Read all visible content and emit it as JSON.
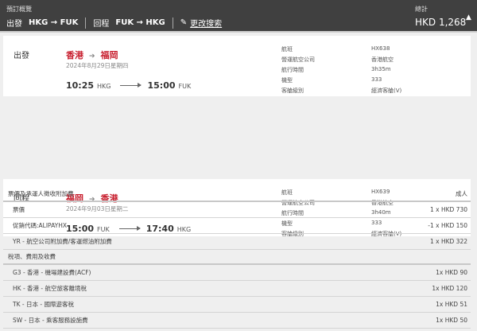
{
  "header": {
    "title": "預訂概覽",
    "outbound_label": "出發",
    "outbound_route": "HKG → FUK",
    "return_label": "回程",
    "return_route": "FUK → HKG",
    "edit_label": "更改搜索",
    "total_label": "總計",
    "total_amount": "HKD 1,268"
  },
  "flights": [
    {
      "label": "出發",
      "from": "香港",
      "to": "福岡",
      "date": "2024年8月29日星期四",
      "dep_time": "10:25",
      "dep_code": "HKG",
      "arr_time": "15:00",
      "arr_code": "FUK",
      "details": [
        {
          "k": "航班",
          "v": "HX638"
        },
        {
          "k": "營運航空公司",
          "v": "香港航空"
        },
        {
          "k": "航行時間",
          "v": "3h35m"
        },
        {
          "k": "機型",
          "v": "333"
        },
        {
          "k": "客艙級別",
          "v": "經濟客艙(V)"
        }
      ]
    },
    {
      "label": "回程",
      "from": "福岡",
      "to": "香港",
      "date": "2024年9月03日星期二",
      "dep_time": "15:00",
      "dep_code": "FUK",
      "arr_time": "17:40",
      "arr_code": "HKG",
      "details": [
        {
          "k": "航班",
          "v": "HX639"
        },
        {
          "k": "營運航空公司",
          "v": "香港航空"
        },
        {
          "k": "航行時間",
          "v": "3h40m"
        },
        {
          "k": "機型",
          "v": "333"
        },
        {
          "k": "客艙級別",
          "v": "經濟客艙(V)"
        }
      ]
    }
  ],
  "price": {
    "fare_header": "票價及承運人徵收附加費",
    "passenger_type": "成人",
    "fare_rows": [
      {
        "k": "票價",
        "v": "1 x HKD 730"
      },
      {
        "k": "促銷代碼:ALIPAYHX",
        "v": "-1 x HKD 150"
      },
      {
        "k": "YR - 航空公司附加費/客運燃油附加費",
        "v": "1 x HKD 322"
      }
    ],
    "tax_header": "稅項、費用及收費",
    "tax_rows": [
      {
        "k": "G3 - 香港 - 機場建設費(ACF)",
        "v": "1x HKD 90"
      },
      {
        "k": "HK - 香港 - 航空旅客離境稅",
        "v": "1x HKD 120"
      },
      {
        "k": "TK - 日本 - 國際遊客稅",
        "v": "1x HKD 51"
      },
      {
        "k": "SW - 日本 - 乘客服務設施費",
        "v": "1x HKD 50"
      }
    ]
  }
}
